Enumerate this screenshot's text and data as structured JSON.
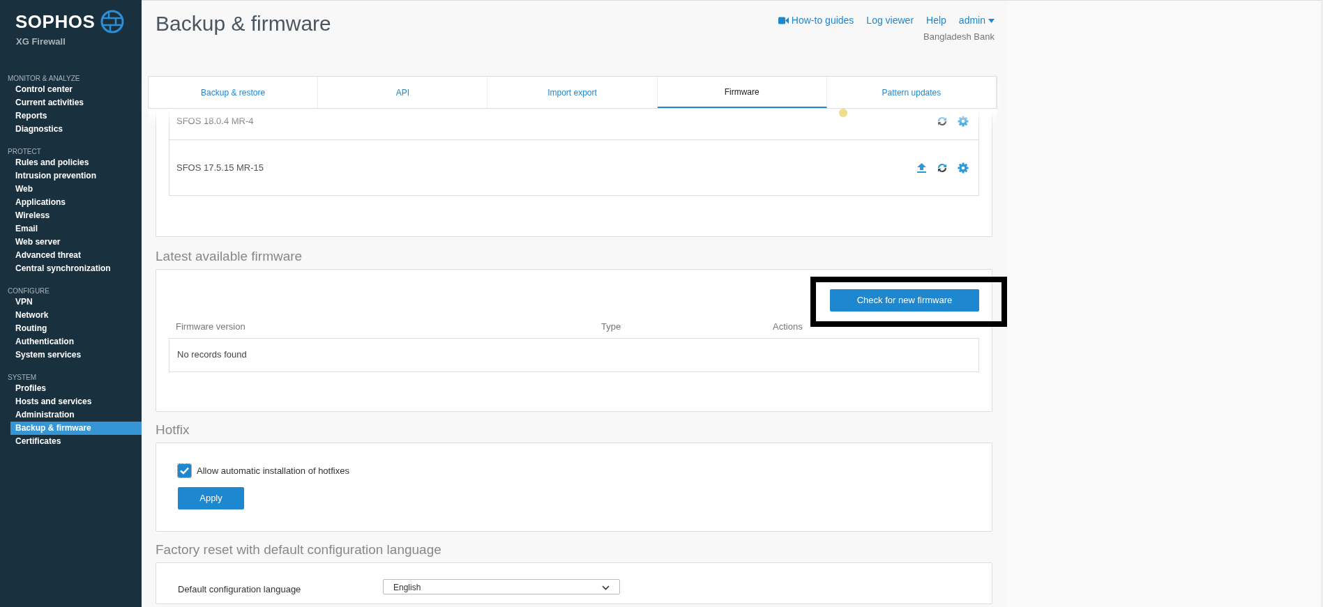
{
  "brand": {
    "name": "SOPHOS",
    "product": "XG Firewall"
  },
  "sidebar": {
    "sections": [
      {
        "title": "MONITOR & ANALYZE",
        "items": [
          {
            "label": "Control center",
            "selected": false
          },
          {
            "label": "Current activities",
            "selected": false
          },
          {
            "label": "Reports",
            "selected": false
          },
          {
            "label": "Diagnostics",
            "selected": false
          }
        ]
      },
      {
        "title": "PROTECT",
        "items": [
          {
            "label": "Rules and policies",
            "selected": false
          },
          {
            "label": "Intrusion prevention",
            "selected": false
          },
          {
            "label": "Web",
            "selected": false
          },
          {
            "label": "Applications",
            "selected": false
          },
          {
            "label": "Wireless",
            "selected": false
          },
          {
            "label": "Email",
            "selected": false
          },
          {
            "label": "Web server",
            "selected": false
          },
          {
            "label": "Advanced threat",
            "selected": false
          },
          {
            "label": "Central synchronization",
            "selected": false
          }
        ]
      },
      {
        "title": "CONFIGURE",
        "items": [
          {
            "label": "VPN",
            "selected": false
          },
          {
            "label": "Network",
            "selected": false
          },
          {
            "label": "Routing",
            "selected": false
          },
          {
            "label": "Authentication",
            "selected": false
          },
          {
            "label": "System services",
            "selected": false
          }
        ]
      },
      {
        "title": "SYSTEM",
        "items": [
          {
            "label": "Profiles",
            "selected": false
          },
          {
            "label": "Hosts and services",
            "selected": false
          },
          {
            "label": "Administration",
            "selected": false
          },
          {
            "label": "Backup & firmware",
            "selected": true
          },
          {
            "label": "Certificates",
            "selected": false
          }
        ]
      }
    ]
  },
  "page_title": "Backup & firmware",
  "header_links": [
    {
      "label": "How-to guides",
      "kind": "video"
    },
    {
      "label": "Log viewer",
      "kind": "plain"
    },
    {
      "label": "Help",
      "kind": "plain"
    },
    {
      "label": "admin",
      "kind": "menu"
    }
  ],
  "organization": "Bangladesh Bank",
  "tabs": [
    {
      "label": "Backup & restore",
      "selected": false
    },
    {
      "label": "API",
      "selected": false
    },
    {
      "label": "Import export",
      "selected": false
    },
    {
      "label": "Firmware",
      "selected": true
    },
    {
      "label": "Pattern updates",
      "selected": false
    }
  ],
  "installed_firmware": [
    {
      "version": "SFOS 18.0.4 MR-4",
      "color": "#f0dc8c",
      "actions": [
        {
          "kind": "reboot"
        },
        {
          "kind": "settings"
        }
      ]
    },
    {
      "version": "SFOS 17.5.15 MR-15",
      "actions": [
        {
          "kind": "upload"
        },
        {
          "kind": "reboot"
        },
        {
          "kind": "settings"
        }
      ]
    }
  ],
  "latest_firmware": {
    "heading": "Latest available firmware",
    "button": "Check for new firmware",
    "columns": [
      "Firmware version",
      "Type",
      "Actions"
    ],
    "empty_text": "No records found"
  },
  "hotfix": {
    "heading": "Hotfix",
    "checkbox": {
      "label": "Allow automatic installation of hotfixes",
      "checked": true
    },
    "button": "Apply"
  },
  "factory_reset": {
    "heading": "Factory reset with default configuration language",
    "field_label": "Default configuration language",
    "value": "English"
  }
}
